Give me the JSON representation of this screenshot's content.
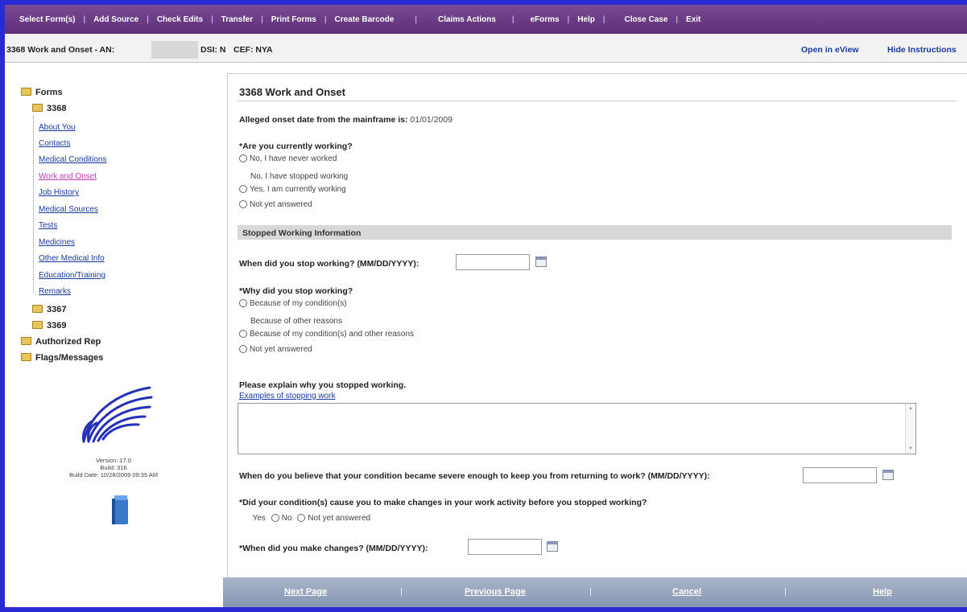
{
  "menu": {
    "items": [
      "Select Form(s)",
      "Add Source",
      "Check Edits",
      "Transfer",
      "Print Forms",
      "Create Barcode",
      "Claims Actions",
      "eForms",
      "Help",
      "Close Case",
      "Exit"
    ]
  },
  "header": {
    "form_label": "3368 Work and Onset - AN:",
    "dsi": "DSI: N",
    "cef": "CEF: NYA",
    "open_eview": "Open in eView",
    "hide_instructions": "Hide Instructions"
  },
  "sidebar": {
    "root": "Forms",
    "form_3368": "3368",
    "links": [
      "About You",
      "Contacts",
      "Medical Conditions",
      "Work and Onset",
      "Job History",
      "Medical Sources",
      "Tests",
      "Medicines",
      "Other Medical Info",
      "Education/Training",
      "Remarks"
    ],
    "active_link": "Work and Onset",
    "form_3367": "3367",
    "form_3369": "3369",
    "authorized_rep": "Authorized Rep",
    "flags_messages": "Flags/Messages",
    "version": "Version: 17.0",
    "build": "Build: 316",
    "build_date": "Build Date: 10/28/2009 09:35 AM"
  },
  "form": {
    "title": "3368 Work and Onset",
    "onset_label": "Alleged onset date from the mainframe is:",
    "onset_value": "01/01/2009",
    "q_working": "*Are you currently working?",
    "working_options": [
      "No, I have never worked",
      "No, I have stopped working",
      "Yes, I am currently working",
      "Not yet answered"
    ],
    "section_stopped": "Stopped Working Information",
    "q_stop_date": "When did you stop working? (MM/DD/YYYY):",
    "q_why_stop": "*Why did you stop working?",
    "why_options": [
      "Because of my condition(s)",
      "Because of other reasons",
      "Because of my condition(s) and other reasons",
      "Not yet answered"
    ],
    "q_explain": "Please explain why you stopped working.",
    "examples_link": "Examples of stopping work",
    "q_severe": "When do you believe that your condition became severe enough to keep you from returning to work? (MM/DD/YYYY):",
    "q_changes": "*Did your condition(s) cause you to make changes in your work activity before you stopped working?",
    "changes_options": [
      "Yes",
      "No",
      "Not yet answered"
    ],
    "q_changes_date": "*When did you make changes? (MM/DD/YYYY):"
  },
  "bottom_nav": {
    "next": "Next Page",
    "previous": "Previous Page",
    "cancel": "Cancel",
    "help": "Help"
  }
}
